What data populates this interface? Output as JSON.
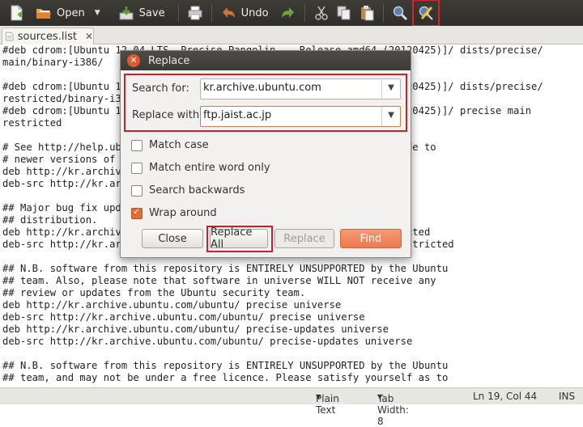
{
  "toolbar": {
    "open_label": "Open",
    "save_label": "Save",
    "undo_label": "Undo"
  },
  "tab": {
    "title": "sources.list"
  },
  "editor_lines": [
    "#deb cdrom:[Ubuntu 12.04 LTS _Precise Pangolin_ - Release amd64 (20120425)]/ dists/precise/",
    "main/binary-i386/",
    "",
    "#deb cdrom:[Ubuntu 12.04 LTS _Precise Pangolin_ - Release amd64 (20120425)]/ dists/precise/",
    "restricted/binary-i386/",
    "#deb cdrom:[Ubuntu 12.04 LTS _Precise Pangolin_ - Release amd64 (20120425)]/ precise main",
    "restricted",
    "",
    "# See http://help.ubuntu.com/community/UpgradeNotes for how to upgrade to",
    "# newer versions of the distribution.",
    "deb http://kr.archive.ubuntu.com/ubuntu/ precise main restricted",
    "deb-src http://kr.archive.ubuntu.com/ubuntu/ precise main restricted",
    "",
    "## Major bug fix updates produced after the final release of the",
    "## distribution.",
    "deb http://kr.archive.ubuntu.com/ubuntu/ precise-updates main restricted",
    "deb-src http://kr.archive.ubuntu.com/ubuntu/ precise-updates main restricted",
    "",
    "## N.B. software from this repository is ENTIRELY UNSUPPORTED by the Ubuntu",
    "## team. Also, please note that software in universe WILL NOT receive any",
    "## review or updates from the Ubuntu security team.",
    "deb http://kr.archive.ubuntu.com/ubuntu/ precise universe",
    "deb-src http://kr.archive.ubuntu.com/ubuntu/ precise universe",
    "deb http://kr.archive.ubuntu.com/ubuntu/ precise-updates universe",
    "deb-src http://kr.archive.ubuntu.com/ubuntu/ precise-updates universe",
    "",
    "## N.B. software from this repository is ENTIRELY UNSUPPORTED by the Ubuntu",
    "## team, and may not be under a free licence. Please satisfy yourself as to"
  ],
  "dialog": {
    "title": "Replace",
    "search_label": "Search for:",
    "search_value": "kr.archive.ubuntu.com",
    "replace_label": "Replace with:",
    "replace_value": "ftp.jaist.ac.jp",
    "options": {
      "match_case": "Match case",
      "match_word": "Match entire word only",
      "search_backwards": "Search backwards",
      "wrap_around": "Wrap around"
    },
    "buttons": {
      "close": "Close",
      "replace_all": "Replace All",
      "replace": "Replace",
      "find": "Find"
    }
  },
  "status": {
    "language": "Plain Text",
    "tab_width": "Tab Width: 8",
    "position": "Ln 19, Col 44",
    "mode": "INS"
  },
  "colors": {
    "highlight": "#c91f2b",
    "find_button": "#ec7a4d",
    "close_button": "#e3572f"
  }
}
